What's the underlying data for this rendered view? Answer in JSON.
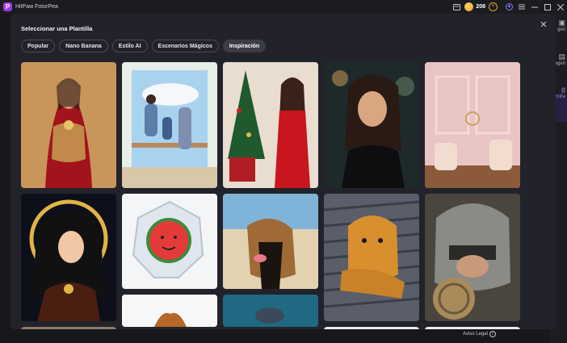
{
  "app": {
    "title": "HitPaw FotorPea",
    "credits": "208"
  },
  "modal": {
    "title": "Seleccionar una Plantilla",
    "tabs": [
      "Popular",
      "Nano Banana",
      "Estilo AI",
      "Escenarios Mágicos",
      "Inspiración"
    ],
    "active_tab": "Inspiración"
  },
  "templates": [
    {
      "subject": "bride-in-red-lehenga"
    },
    {
      "subject": "family-at-window-balcony"
    },
    {
      "subject": "woman-red-dress-christmas-tree"
    },
    {
      "subject": "woman-black-dress-night-lights"
    },
    {
      "subject": "pink-vintage-room-armchairs"
    },
    {
      "subject": "illustrated-woman-golden-moon"
    },
    {
      "subject": "watermelon-glass-crystal"
    },
    {
      "subject": "dog-on-beach"
    },
    {
      "subject": "golden-retriever-on-slats"
    },
    {
      "subject": "knight-helmet-armor"
    },
    {
      "subject": "partial-row-1"
    },
    {
      "subject": "partial-row-2"
    },
    {
      "subject": "partial-row-3"
    },
    {
      "subject": "partial-row-4"
    },
    {
      "subject": "partial-row-5"
    }
  ],
  "footer": {
    "legal": "Aviso Legal"
  },
  "background_sidebar": {
    "items": [
      "gen",
      "agen",
      "ntilla"
    ],
    "active": "ntilla"
  }
}
